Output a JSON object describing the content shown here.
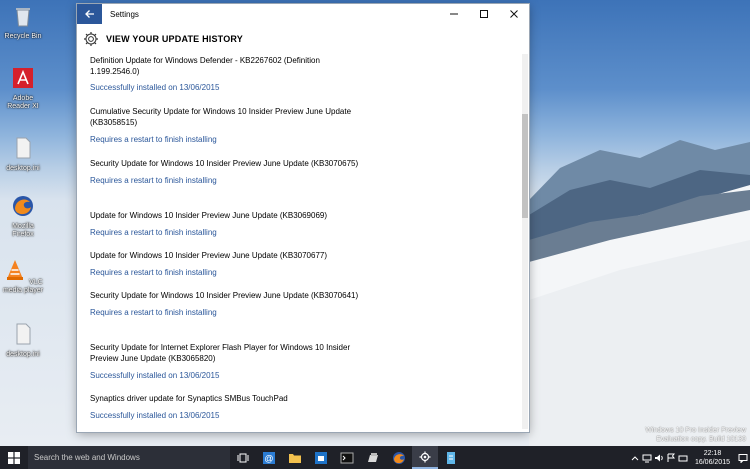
{
  "desktop": {
    "icons": [
      {
        "label": "Recycle Bin",
        "icon": "recycle-bin-icon"
      },
      {
        "label": "Adobe Reader XI",
        "icon": "adobe-reader-icon"
      },
      {
        "label": "desktop.ini",
        "icon": "file-icon"
      },
      {
        "label": "Mozilla Firefox",
        "icon": "firefox-icon"
      },
      {
        "label": "VLC media player",
        "icon": "vlc-icon"
      },
      {
        "label": "desktop.ini",
        "icon": "file-icon"
      }
    ],
    "watermark": {
      "line1": "Windows 10 Pro Insider Preview",
      "line2": "Evaluation copy. Build 10130"
    }
  },
  "window": {
    "title": "Settings",
    "page_title": "VIEW YOUR UPDATE HISTORY",
    "updates": [
      {
        "name": "Definition Update for Windows Defender - KB2267602 (Definition 1.199.2546.0)",
        "status": "Successfully installed on 13/06/2015"
      },
      {
        "name": "Cumulative Security Update for Windows 10 Insider Preview June Update (KB3058515)",
        "status": "Requires a restart to finish installing"
      },
      {
        "name": "Security Update for Windows 10 Insider Preview June Update (KB3070675)",
        "status": "Requires a restart to finish installing"
      },
      {
        "name": "Update for Windows 10 Insider Preview June Update (KB3069069)",
        "status": "Requires a restart to finish installing"
      },
      {
        "name": "Update for Windows 10 Insider Preview June Update (KB3070677)",
        "status": "Requires a restart to finish installing"
      },
      {
        "name": "Security Update for Windows 10 Insider Preview June Update (KB3070641)",
        "status": "Requires a restart to finish installing"
      },
      {
        "name": "Security Update for Internet Explorer Flash Player for Windows 10 Insider Preview June Update (KB3065820)",
        "status": "Successfully installed on 13/06/2015"
      },
      {
        "name": "Synaptics driver update for Synaptics SMBus TouchPad",
        "status": "Successfully installed on 13/06/2015"
      }
    ]
  },
  "taskbar": {
    "search_placeholder": "Search the web and Windows",
    "clock_time": "22:18",
    "clock_date": "16/06/2015"
  },
  "colors": {
    "accent": "#2b579a",
    "taskbar": "#1f2128"
  }
}
